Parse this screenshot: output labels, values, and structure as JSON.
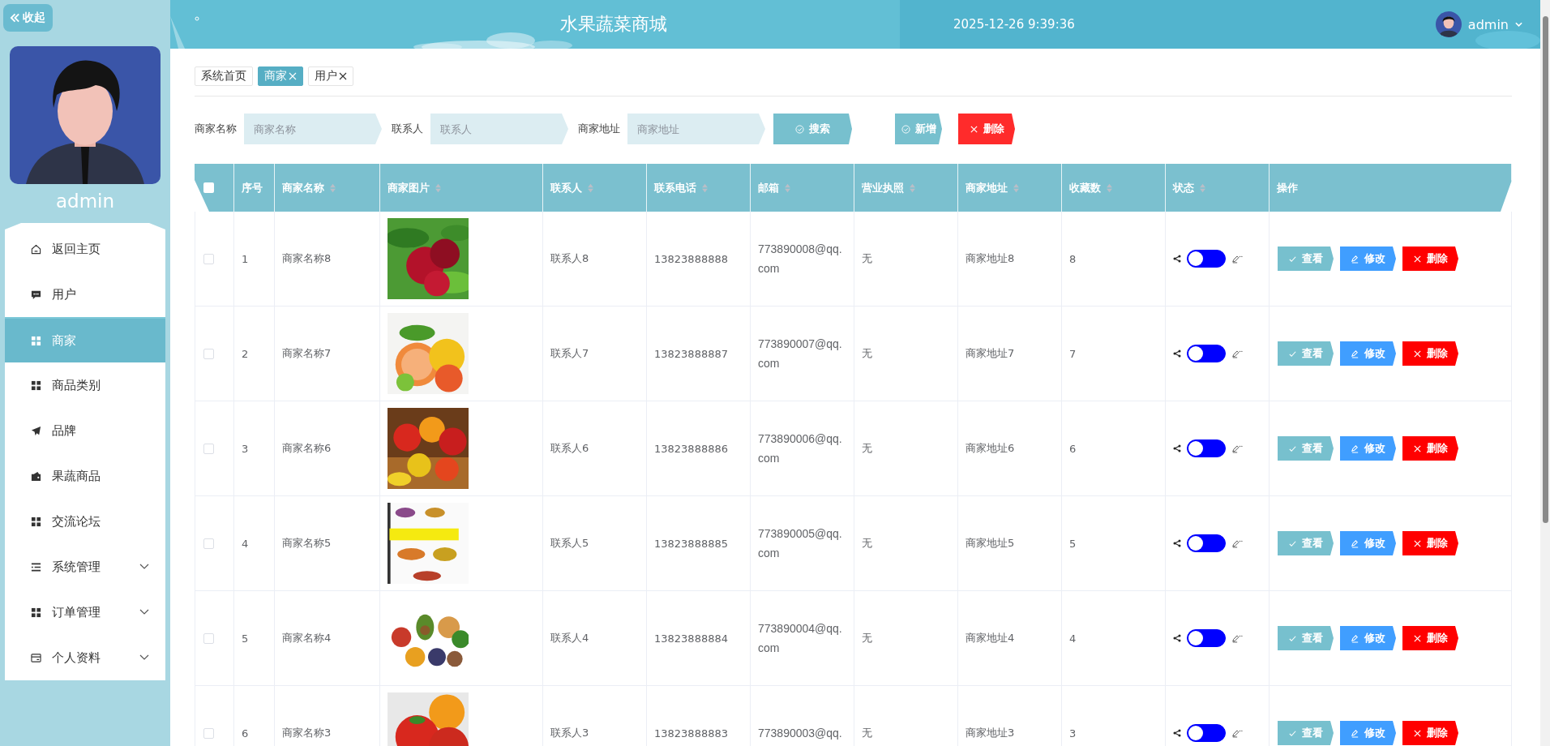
{
  "sidebar": {
    "collapse_button": "收起",
    "username": "admin",
    "menu": [
      {
        "label": "返回主页",
        "kind": "home",
        "selected": false,
        "expandable": false
      },
      {
        "label": "用户",
        "kind": "chat",
        "selected": false,
        "expandable": false
      },
      {
        "label": "商家",
        "kind": "grid",
        "selected": true,
        "expandable": false
      },
      {
        "label": "商品类别",
        "kind": "grid",
        "selected": false,
        "expandable": false
      },
      {
        "label": "品牌",
        "kind": "plane",
        "selected": false,
        "expandable": false
      },
      {
        "label": "果蔬商品",
        "kind": "wallet",
        "selected": false,
        "expandable": false
      },
      {
        "label": "交流论坛",
        "kind": "grid",
        "selected": false,
        "expandable": false
      },
      {
        "label": "系统管理",
        "kind": "list",
        "selected": false,
        "expandable": true
      },
      {
        "label": "订单管理",
        "kind": "grid",
        "selected": false,
        "expandable": true
      },
      {
        "label": "个人资料",
        "kind": "card",
        "selected": false,
        "expandable": true
      }
    ]
  },
  "header": {
    "title": "水果蔬菜商城",
    "datetime": "2025-12-26 9:39:36",
    "user": "admin"
  },
  "tabs": [
    {
      "label": "系统首页",
      "selected": false,
      "closable": false
    },
    {
      "label": "商家",
      "selected": true,
      "closable": true
    },
    {
      "label": "用户",
      "selected": false,
      "closable": true
    }
  ],
  "search": {
    "fields": [
      {
        "label": "商家名称",
        "placeholder": "商家名称"
      },
      {
        "label": "联系人",
        "placeholder": "联系人"
      },
      {
        "label": "商家地址",
        "placeholder": "商家地址"
      }
    ],
    "search_button": "搜索",
    "add_button": "新增",
    "delete_button": "删除"
  },
  "table": {
    "columns": [
      {
        "kind": "checkbox",
        "checked": false
      },
      {
        "kind": "text",
        "label": "序号",
        "sortable": false
      },
      {
        "kind": "text",
        "label": "商家名称",
        "sortable": true
      },
      {
        "kind": "text",
        "label": "商家图片",
        "sortable": true
      },
      {
        "kind": "text",
        "label": "联系人",
        "sortable": true
      },
      {
        "kind": "text",
        "label": "联系电话",
        "sortable": true
      },
      {
        "kind": "text",
        "label": "邮箱",
        "sortable": true
      },
      {
        "kind": "text",
        "label": "营业执照",
        "sortable": true
      },
      {
        "kind": "text",
        "label": "商家地址",
        "sortable": true
      },
      {
        "kind": "text",
        "label": "收藏数",
        "sortable": true
      },
      {
        "kind": "text",
        "label": "状态",
        "sortable": true
      },
      {
        "kind": "text",
        "label": "操作",
        "sortable": false
      }
    ],
    "rows": [
      {
        "selected": false,
        "index": "1",
        "name": "商家名称8",
        "contact": "联系人8",
        "phone": "13823888888",
        "email": "773890008@qq.com",
        "license": "无",
        "address": "商家地址8",
        "favorites": "8",
        "on": false,
        "actions": [
          "查看",
          "修改",
          "删除"
        ]
      },
      {
        "selected": false,
        "index": "2",
        "name": "商家名称7",
        "contact": "联系人7",
        "phone": "13823888887",
        "email": "773890007@qq.com",
        "license": "无",
        "address": "商家地址7",
        "favorites": "7",
        "on": false,
        "actions": [
          "查看",
          "修改",
          "删除"
        ]
      },
      {
        "selected": false,
        "index": "3",
        "name": "商家名称6",
        "contact": "联系人6",
        "phone": "13823888886",
        "email": "773890006@qq.com",
        "license": "无",
        "address": "商家地址6",
        "favorites": "6",
        "on": false,
        "actions": [
          "查看",
          "修改",
          "删除"
        ]
      },
      {
        "selected": false,
        "index": "4",
        "name": "商家名称5",
        "contact": "联系人5",
        "phone": "13823888885",
        "email": "773890005@qq.com",
        "license": "无",
        "address": "商家地址5",
        "favorites": "5",
        "on": false,
        "actions": [
          "查看",
          "修改",
          "删除"
        ]
      },
      {
        "selected": false,
        "index": "5",
        "name": "商家名称4",
        "contact": "联系人4",
        "phone": "13823888884",
        "email": "773890004@qq.com",
        "license": "无",
        "address": "商家地址4",
        "favorites": "4",
        "on": false,
        "actions": [
          "查看",
          "修改",
          "删除"
        ]
      },
      {
        "selected": false,
        "index": "6",
        "name": "商家名称3",
        "contact": "联系人3",
        "phone": "13823888883",
        "email": "773890003@qq.",
        "license": "无",
        "address": "商家地址3",
        "favorites": "3",
        "on": false,
        "actions": [
          "查看",
          "修改",
          "删除"
        ]
      }
    ]
  }
}
